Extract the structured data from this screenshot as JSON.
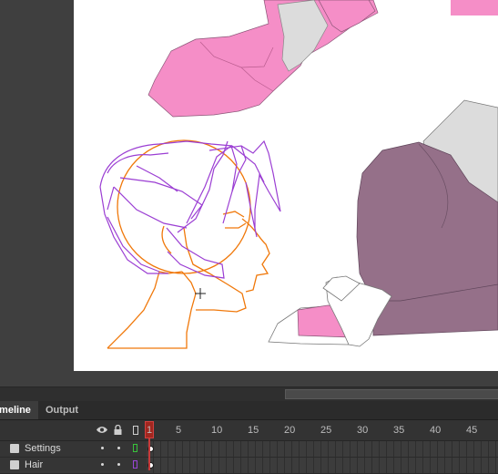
{
  "panel": {
    "tabs": [
      {
        "label": "imeline"
      },
      {
        "label": "Output"
      }
    ]
  },
  "timeline": {
    "ruler_numbers": [
      "1",
      "5",
      "10",
      "15",
      "20",
      "25",
      "30",
      "35",
      "40",
      "45"
    ],
    "layers": [
      {
        "name": "Settings",
        "outline_color": "#38c43b"
      },
      {
        "name": "Hair",
        "outline_color": "#9a46d6"
      }
    ],
    "icons": {
      "visibility": "eye-icon",
      "lock": "lock-icon",
      "outline": "outline-icon"
    }
  },
  "colors": {
    "pink_fill": "#f58ec7",
    "purple_fill": "#957089",
    "gray_fill": "#dcdcdc",
    "orange_stroke": "#f0780a",
    "purple_stroke": "#9b3ed3",
    "playhead": "#c73a3a"
  }
}
